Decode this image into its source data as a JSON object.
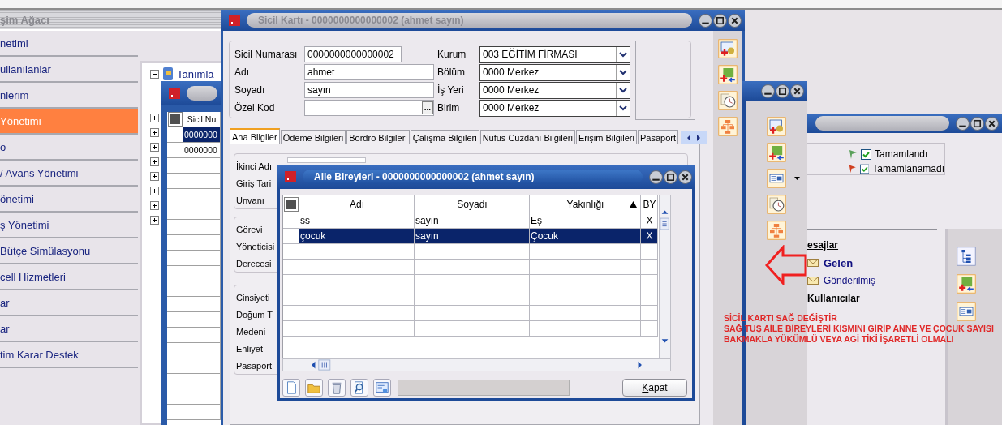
{
  "navigation": {
    "title": "şim Ağacı",
    "items": [
      {
        "label": "netimi",
        "selected": false
      },
      {
        "label": "ullanılanlar",
        "selected": false
      },
      {
        "label": "nlerim",
        "selected": false
      },
      {
        "label": "Yönetimi",
        "selected": true
      },
      {
        "label": "o",
        "selected": false
      },
      {
        "label": "/ Avans Yönetimi",
        "selected": false
      },
      {
        "label": "önetimi",
        "selected": false
      },
      {
        "label": "ş Yönetimi",
        "selected": false
      },
      {
        "label": "Bütçe Simülasyonu",
        "selected": false
      },
      {
        "label": "cell Hizmetleri",
        "selected": false
      },
      {
        "label": "ar",
        "selected": false
      },
      {
        "label": "ar",
        "selected": false
      },
      {
        "label": "tim Karar Destek",
        "selected": false
      }
    ]
  },
  "tree": {
    "root": {
      "label": "Tanımla",
      "expanded": true
    },
    "nodes": [
      {
        "expanded": false
      },
      {
        "expanded": false
      },
      {
        "expanded": false
      },
      {
        "expanded": false
      },
      {
        "expanded": false
      },
      {
        "expanded": false
      },
      {
        "expanded": false
      },
      {
        "expanded": false
      }
    ]
  },
  "list_window": {
    "active": false,
    "column": "Sicil Nu",
    "rows": [
      {
        "value": "0000000",
        "selected": true
      },
      {
        "value": "0000000",
        "selected": false
      }
    ]
  },
  "sicil_karti": {
    "title": "Sicil Kartı - 0000000000000002 (ahmet sayın)",
    "active": false,
    "left_fields": [
      {
        "label": "Sicil Numarası",
        "value": "0000000000000002",
        "kind": "short"
      },
      {
        "label": "Adı",
        "value": "ahmet",
        "kind": "text"
      },
      {
        "label": "Soyadı",
        "value": "sayın",
        "kind": "text"
      },
      {
        "label": "Özel Kod",
        "kind": "lookup",
        "button": "..."
      }
    ],
    "right_fields": [
      {
        "label": "Kurum",
        "value": "003 EĞİTİM FİRMASI"
      },
      {
        "label": "Bölüm",
        "value": "0000 Merkez"
      },
      {
        "label": "İş Yeri",
        "value": "0000 Merkez"
      },
      {
        "label": "Birim",
        "value": "0000 Merkez"
      }
    ],
    "tabs": [
      {
        "label": "Ana Bilgiler",
        "selected": true
      },
      {
        "label": "Ödeme Bilgileri",
        "selected": false
      },
      {
        "label": "Bordro Bilgileri",
        "selected": false
      },
      {
        "label": "Çalışma Bilgileri",
        "selected": false
      },
      {
        "label": "Nüfus Cüzdanı Bilgileri",
        "selected": false
      },
      {
        "label": "Erişim Bilgileri",
        "selected": false
      },
      {
        "label": "Pasaport",
        "selected": false
      }
    ],
    "detail_groups": [
      [
        "İkinci Adı",
        "Giriş Tari",
        "Unvanı"
      ],
      [
        "Görevi",
        "Yöneticisi",
        "Derecesi"
      ],
      [
        "Cinsiyeti",
        "Doğum T",
        "Medeni",
        "Ehliyet",
        "Pasaport"
      ]
    ]
  },
  "aile_bireyleri": {
    "title": "Aile Bireyleri - 0000000000000002 (ahmet sayın)",
    "active": true,
    "columns": [
      {
        "label": "Adı",
        "sorted_ascending": false
      },
      {
        "label": "Soyadı",
        "sorted_ascending": false
      },
      {
        "label": "Yakınlığı",
        "sorted_ascending": true
      },
      {
        "label": "BY",
        "sorted_ascending": false
      }
    ],
    "rows": [
      {
        "cells": [
          "ss",
          "sayın",
          "Eş",
          "X"
        ],
        "selected": false
      },
      {
        "cells": [
          "çocuk",
          "sayın",
          "Çocuk",
          "X"
        ],
        "selected": true
      }
    ],
    "close_button": "Kapat"
  },
  "task_window": {
    "active": false,
    "filters": [
      {
        "label": "Tamamlandı",
        "checked": true,
        "color": "#5aa05a"
      },
      {
        "label": "Tamamlanamadı",
        "checked": true,
        "color": "#d04020"
      }
    ]
  },
  "messages": [
    {
      "label": "esajlar",
      "kind": "heading"
    },
    {
      "label": "Gelen",
      "kind": "unread_folder"
    },
    {
      "label": "Gönderilmiş",
      "kind": "folder"
    },
    {
      "label": "Kullanıcılar",
      "kind": "heading"
    }
  ],
  "annotation": {
    "lines": [
      "SİCİL KARTI SAĞ DEĞİŞTİR",
      "SAĞ TUŞ AİLE BİREYLERİ KISMINI GİRİP ANNE VE ÇOCUK SAYISI",
      "BAKMAKLA YÜKÜMLÜ VEYA AGİ TİKİ İŞARETLİ OLMALI"
    ]
  }
}
